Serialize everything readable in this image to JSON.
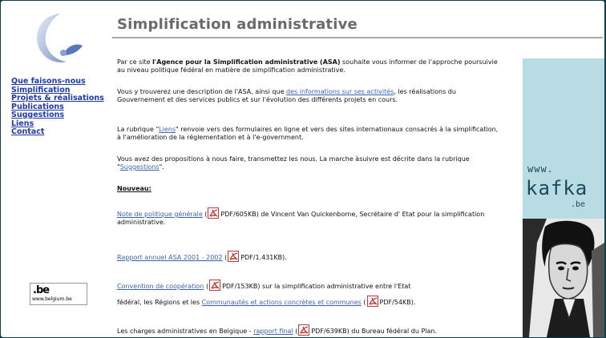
{
  "page": {
    "title": "Simplification administrative"
  },
  "nav": {
    "items": [
      {
        "label": "Que faisons-nous"
      },
      {
        "label": "Simplification"
      },
      {
        "label": "Projets & réalisations"
      },
      {
        "label": "Publications"
      },
      {
        "label": "Suggestions"
      },
      {
        "label": "Liens"
      },
      {
        "label": "Contact"
      }
    ]
  },
  "belgium_logo": {
    "text": ".be",
    "url": "www.belgium.be"
  },
  "content": {
    "p1_pre": "Par ce site ",
    "p1_bold": "l'Agence pour la Simplification administrative (ASA)",
    "p1_post": " souhaite vous informer de l'approche poursuivie au niveau politique fédéral en matière de simplification administrative.",
    "p2_pre": "Vous y trouverez une description de l'ASA, ainsi que ",
    "p2_link": "des informations sur ses activités",
    "p2_post": ", les réalisations du Gouvernement et des services publics et sur l'évolution des différents projets en cours.",
    "p3_pre": "La rubrique \"",
    "p3_link": "Liens",
    "p3_post": "\" renvoie vers des formulaires en ligne et vers des sites internationaux consacrés à la simplification, à l'amélioration de la réglementation et à l'e-government.",
    "p4_pre": "Vous avez des propositions à nous faire, transmettez les nous. La marche àsuivre est décrite dans la rubrique \"",
    "p4_link": "Suggestions",
    "p4_post": "\".",
    "nouveau": "Nouveau:",
    "n1_link": "Note de politique générale",
    "n1_pdf": "PDF/605KB",
    "n1_post": ") de Vincent Van Quickenborne, Secrétaire d' Etat pour la simplification administrative.",
    "n2_link": "Rapport annuel ASA 2001 - 2002",
    "n2_pdf": "PDF/1.431KB",
    "n2_post": ").",
    "n3_link": "Convention de coopération",
    "n3_pdf": "PDF/153KB",
    "n3_post": ") sur la simplification administrative entre l'Etat",
    "n3b_pre": "fédéral, les Régions et les ",
    "n3b_link": "Communautés et actions concrètes et communes",
    "n3b_pdf": "PDF/54KB",
    "n3b_post": ").",
    "n4_pre": "Les charges administratives en Belgique - ",
    "n4_link": "rapport final",
    "n4_pdf": "PDF/639KB",
    "n4_post": ") du Bureau fédéral du Plan."
  },
  "kafka": {
    "www": "www.",
    "name": "kafka",
    "tld": ".be"
  },
  "colors": {
    "link": "#3c64b4",
    "nav_link": "#1f3aa8",
    "title": "#6a6a6a",
    "side_panel": "#b9dbe4",
    "outer_border": "#0f3f49"
  },
  "icons": [
    "logo-swirl-icon",
    "pdf-icon"
  ]
}
